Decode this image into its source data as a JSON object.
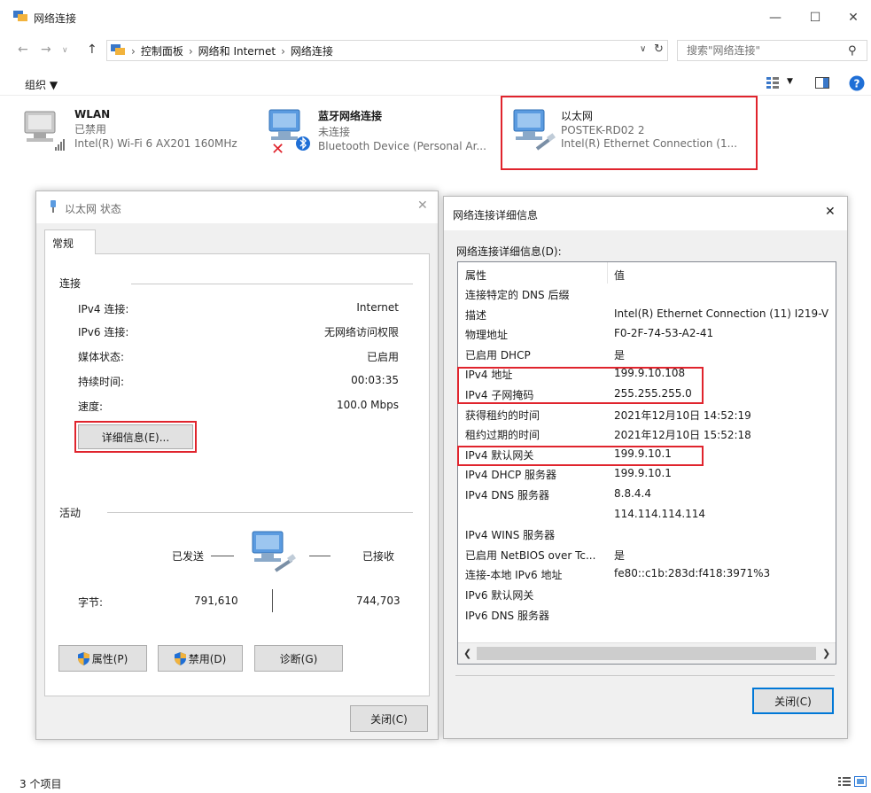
{
  "window": {
    "title": "网络连接",
    "minimize": "—",
    "maximize": "☐",
    "close": "✕"
  },
  "address": {
    "crumbs": [
      "控制面板",
      "网络和 Internet",
      "网络连接"
    ],
    "search_placeholder": "搜索\"网络连接\""
  },
  "toolbar": {
    "organize": "组织 ▼"
  },
  "connections": [
    {
      "name": "WLAN",
      "status": "已禁用",
      "device": "Intel(R) Wi-Fi 6 AX201 160MHz"
    },
    {
      "name": "蓝牙网络连接",
      "status": "未连接",
      "device": "Bluetooth Device (Personal Ar..."
    },
    {
      "name": "以太网",
      "status": "POSTEK-RD02 2",
      "device": "Intel(R) Ethernet Connection (1..."
    }
  ],
  "status_dialog": {
    "title": "以太网 状态",
    "tab": "常规",
    "connection_group": "连接",
    "rows": [
      {
        "label": "IPv4 连接:",
        "value": "Internet"
      },
      {
        "label": "IPv6 连接:",
        "value": "无网络访问权限"
      },
      {
        "label": "媒体状态:",
        "value": "已启用"
      },
      {
        "label": "持续时间:",
        "value": "00:03:35"
      },
      {
        "label": "速度:",
        "value": "100.0 Mbps"
      }
    ],
    "details_button": "详细信息(E)...",
    "activity_group": "活动",
    "sent_label": "已发送",
    "received_label": "已接收",
    "bytes_label": "字节:",
    "bytes_sent": "791,610",
    "bytes_received": "744,703",
    "properties_button": "属性(P)",
    "disable_button": "禁用(D)",
    "diagnose_button": "诊断(G)",
    "close_button": "关闭(C)"
  },
  "details_dialog": {
    "title": "网络连接详细信息",
    "list_label": "网络连接详细信息(D):",
    "col_property": "属性",
    "col_value": "值",
    "rows": [
      {
        "prop": "连接特定的 DNS 后缀",
        "val": ""
      },
      {
        "prop": "描述",
        "val": "Intel(R) Ethernet Connection (11) I219-V"
      },
      {
        "prop": "物理地址",
        "val": "F0-2F-74-53-A2-41"
      },
      {
        "prop": "已启用 DHCP",
        "val": "是"
      },
      {
        "prop": "IPv4 地址",
        "val": "199.9.10.108"
      },
      {
        "prop": "IPv4 子网掩码",
        "val": "255.255.255.0"
      },
      {
        "prop": "获得租约的时间",
        "val": "2021年12月10日 14:52:19"
      },
      {
        "prop": "租约过期的时间",
        "val": "2021年12月10日 15:52:18"
      },
      {
        "prop": "IPv4 默认网关",
        "val": "199.9.10.1"
      },
      {
        "prop": "IPv4 DHCP 服务器",
        "val": "199.9.10.1"
      },
      {
        "prop": "IPv4 DNS 服务器",
        "val": "8.8.4.4"
      },
      {
        "prop": "",
        "val": "114.114.114.114"
      },
      {
        "prop": "IPv4 WINS 服务器",
        "val": ""
      },
      {
        "prop": "已启用 NetBIOS over Tc...",
        "val": "是"
      },
      {
        "prop": "连接-本地 IPv6 地址",
        "val": "fe80::c1b:283d:f418:3971%3"
      },
      {
        "prop": "IPv6 默认网关",
        "val": ""
      },
      {
        "prop": "IPv6 DNS 服务器",
        "val": ""
      }
    ],
    "close_button": "关闭(C)"
  },
  "statusbar": {
    "count": "3 个项目"
  },
  "colors": {
    "highlight": "#e0242d",
    "accent": "#0078d7"
  }
}
